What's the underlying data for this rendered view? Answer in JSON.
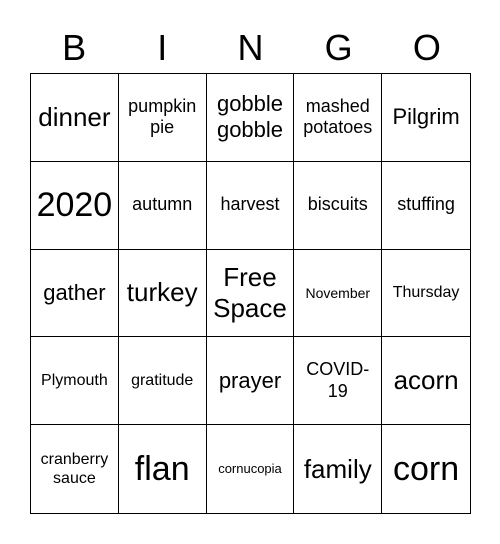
{
  "header": [
    "B",
    "I",
    "N",
    "G",
    "O"
  ],
  "cells": [
    "dinner",
    "pumpkin pie",
    "gobble gobble",
    "mashed potatoes",
    "Pilgrim",
    "2020",
    "autumn",
    "harvest",
    "biscuits",
    "stuffing",
    "gather",
    "turkey",
    "Free Space",
    "November",
    "Thursday",
    "Plymouth",
    "gratitude",
    "prayer",
    "COVID-19",
    "acorn",
    "cranberry sauce",
    "flan",
    "cornucopia",
    "family",
    "corn"
  ]
}
